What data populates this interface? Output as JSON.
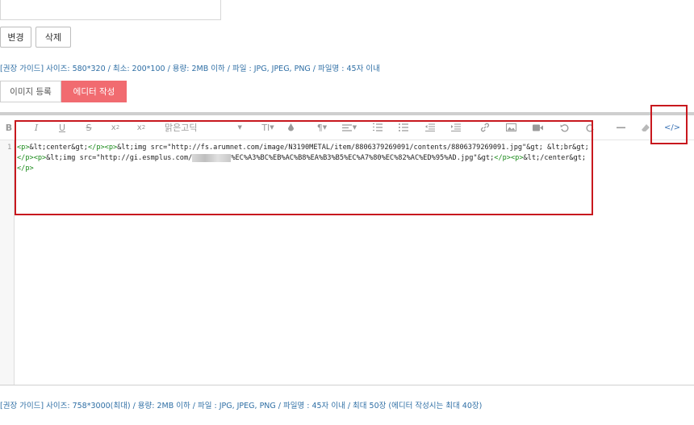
{
  "buttons": {
    "change": "변경",
    "delete": "삭제"
  },
  "guide_top": "[권장 가이드] 사이즈: 580*320 / 최소: 200*100 / 용량: 2MB 이하 / 파일 : JPG, JPEG, PNG / 파일명 : 45자 이내",
  "tabs": {
    "image_register": "이미지 등록",
    "editor_write": "에디터 작성"
  },
  "toolbar": {
    "font_name": "맑은고딕",
    "font_size": "TI",
    "items": [
      "bold-icon",
      "italic-icon",
      "underline-icon",
      "strikethrough-icon",
      "subscript-icon",
      "superscript-icon",
      "font-family-select",
      "font-size-select",
      "color-icon",
      "paragraph-icon",
      "align-icon",
      "ordered-list-icon",
      "unordered-list-icon",
      "outdent-icon",
      "indent-icon",
      "link-icon",
      "image-icon",
      "video-icon",
      "undo-icon",
      "redo-icon",
      "horizontal-rule-icon",
      "eraser-icon",
      "code-view-icon"
    ]
  },
  "code": {
    "line_number": "1",
    "p1": "<p>",
    "t1": "&lt;center&gt;",
    "p2": "</p><p>",
    "t2": "&lt;img src=\"http://fs.arumnet.com/image/N3190METAL/item/8806379269091/contents/8806379269091.jpg\"&gt; &lt;br&gt;",
    "p3": "</p><p>",
    "t3a": "&lt;img src=\"http://gi.esmplus.com/",
    "t3b": "%EC%A3%BC%EB%AC%B8%EA%B3%B5%EC%A7%80%EC%82%AC%ED%95%AD.jpg\"&gt;",
    "p4": "</p><p>",
    "t4": "&lt;/center&gt;",
    "p5": "</p>"
  },
  "guide_bottom": "[권장 가이드] 사이즈: 758*3000(최대) / 용량: 2MB 이하 / 파일 : JPG, JPEG, PNG / 파일명 : 45자 이내 / 최대 50장 (에디터 작성시는 최대 40장)",
  "colors": {
    "accent": "#f16b70",
    "guide_text": "#2f6fa5",
    "highlight_box": "#c8181e",
    "code_tag": "#1a8a1a"
  }
}
